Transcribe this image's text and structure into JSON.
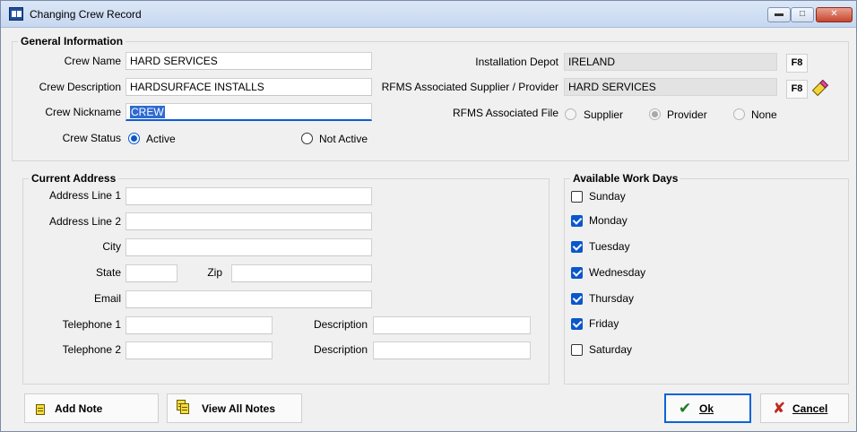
{
  "window": {
    "title": "Changing Crew Record"
  },
  "general": {
    "title": "General Information",
    "crew_name": {
      "label": "Crew Name",
      "value": "HARD SERVICES"
    },
    "crew_description": {
      "label": "Crew Description",
      "value": "HARDSURFACE INSTALLS"
    },
    "crew_nickname": {
      "label": "Crew Nickname",
      "value": "CREW"
    },
    "crew_status": {
      "label": "Crew Status",
      "options": [
        "Active",
        "Not Active"
      ],
      "selected": "Active"
    },
    "installation_depot": {
      "label": "Installation Depot",
      "value": "IRELAND",
      "lookup_label": "F8"
    },
    "rfms_supplier": {
      "label": "RFMS Associated Supplier / Provider",
      "value": "HARD SERVICES",
      "lookup_label": "F8"
    },
    "rfms_file": {
      "label": "RFMS Associated File",
      "options": [
        "Supplier",
        "Provider",
        "None"
      ],
      "selected": "Provider"
    }
  },
  "address": {
    "title": "Current Address",
    "line1": {
      "label": "Address Line 1",
      "value": ""
    },
    "line2": {
      "label": "Address Line 2",
      "value": ""
    },
    "city": {
      "label": "City",
      "value": ""
    },
    "state": {
      "label": "State",
      "value": ""
    },
    "zip": {
      "label": "Zip",
      "value": ""
    },
    "email": {
      "label": "Email",
      "value": ""
    },
    "telephone1": {
      "label": "Telephone 1",
      "value": "",
      "desc_label": "Description",
      "desc_value": ""
    },
    "telephone2": {
      "label": "Telephone 2",
      "value": "",
      "desc_label": "Description",
      "desc_value": ""
    }
  },
  "workdays": {
    "title": "Available Work Days",
    "days": [
      {
        "label": "Sunday",
        "checked": false
      },
      {
        "label": "Monday",
        "checked": true
      },
      {
        "label": "Tuesday",
        "checked": true
      },
      {
        "label": "Wednesday",
        "checked": true
      },
      {
        "label": "Thursday",
        "checked": true
      },
      {
        "label": "Friday",
        "checked": true
      },
      {
        "label": "Saturday",
        "checked": false
      }
    ]
  },
  "buttons": {
    "add_note": "Add Note",
    "view_all_notes": "View All Notes",
    "ok": "Ok",
    "cancel": "Cancel"
  },
  "colors": {
    "accent": "#0a57cc",
    "selection": "#2f6ad1",
    "window_bg": "#f0f0f0",
    "cancel_icon": "#c0281a",
    "ok_icon": "#1b7a22"
  }
}
